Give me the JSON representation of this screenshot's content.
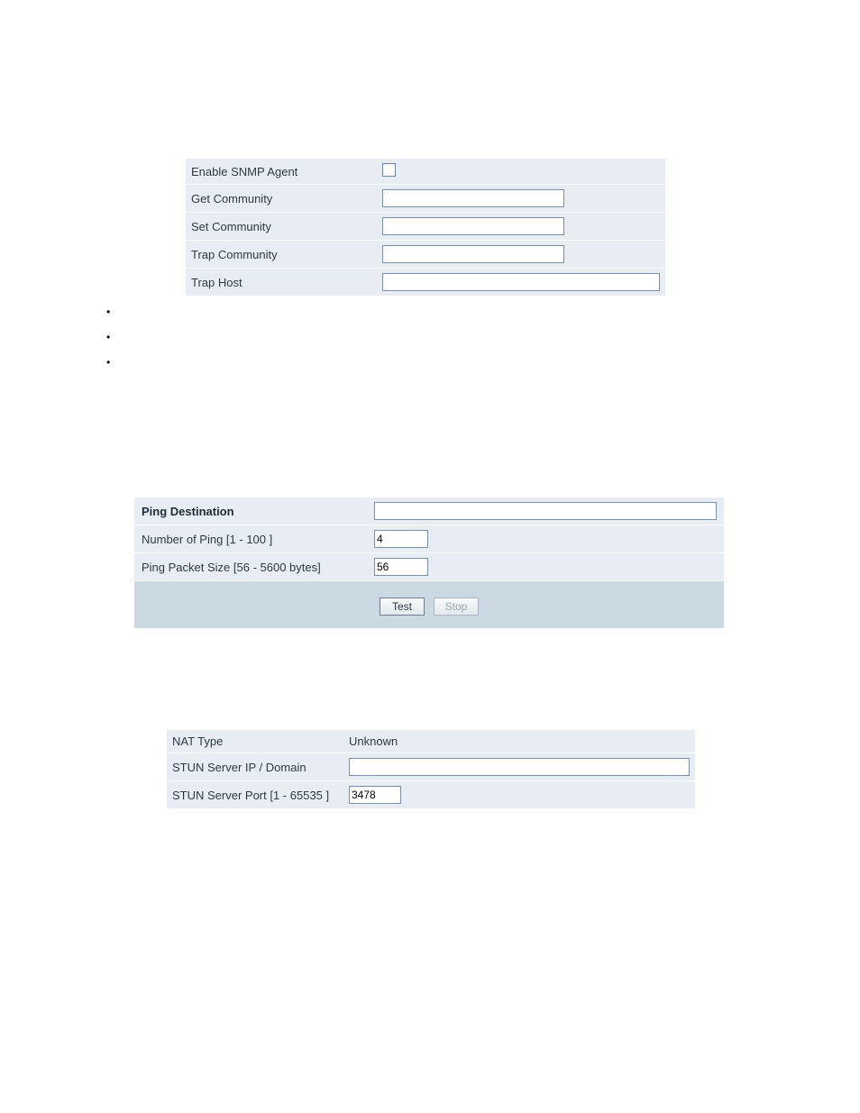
{
  "snmp": {
    "rows": [
      {
        "label": "Enable SNMP Agent",
        "type": "checkbox",
        "checked": false
      },
      {
        "label": "Get Community",
        "type": "text_short",
        "value": ""
      },
      {
        "label": "Set Community",
        "type": "text_short",
        "value": ""
      },
      {
        "label": "Trap Community",
        "type": "text_short",
        "value": ""
      },
      {
        "label": "Trap Host",
        "type": "text_long",
        "value": ""
      }
    ]
  },
  "ping": {
    "header": "Ping Destination",
    "rows": [
      {
        "label": "Number of Ping [1 - 100 ]",
        "value": "4"
      },
      {
        "label": "Ping Packet Size [56 - 5600 bytes]",
        "value": "56"
      }
    ],
    "destination_value": "",
    "buttons": {
      "test": "Test",
      "stop": "Stop"
    }
  },
  "stun": {
    "rows": [
      {
        "label": "NAT Type",
        "type": "static",
        "value": "Unknown"
      },
      {
        "label": "STUN Server IP / Domain",
        "type": "wide",
        "value": ""
      },
      {
        "label": "STUN Server Port [1 - 65535 ]",
        "type": "narrow",
        "value": "3478"
      }
    ]
  }
}
